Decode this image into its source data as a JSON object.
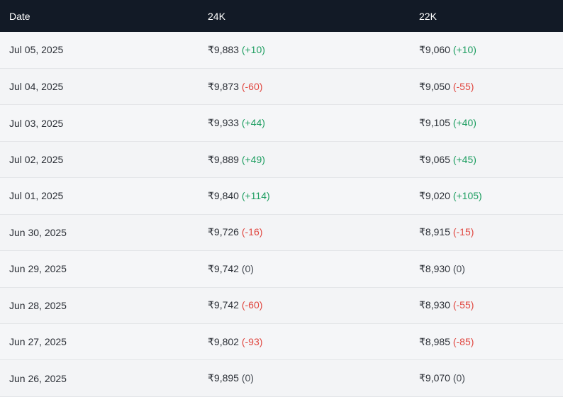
{
  "header": {
    "date_label": "Date",
    "k24_label": "24K",
    "k22_label": "22K"
  },
  "colors": {
    "header_bg": "#121a26",
    "up": "#1e9e61",
    "down": "#e0463f",
    "flat": "#444a52"
  },
  "rows": [
    {
      "date": "Jul 05, 2025",
      "k24": "₹9,883",
      "k24_change": "(+10)",
      "k24_dir": "up",
      "k22": "₹9,060",
      "k22_change": "(+10)",
      "k22_dir": "up"
    },
    {
      "date": "Jul 04, 2025",
      "k24": "₹9,873",
      "k24_change": "(-60)",
      "k24_dir": "down",
      "k22": "₹9,050",
      "k22_change": "(-55)",
      "k22_dir": "down"
    },
    {
      "date": "Jul 03, 2025",
      "k24": "₹9,933",
      "k24_change": "(+44)",
      "k24_dir": "up",
      "k22": "₹9,105",
      "k22_change": "(+40)",
      "k22_dir": "up"
    },
    {
      "date": "Jul 02, 2025",
      "k24": "₹9,889",
      "k24_change": "(+49)",
      "k24_dir": "up",
      "k22": "₹9,065",
      "k22_change": "(+45)",
      "k22_dir": "up"
    },
    {
      "date": "Jul 01, 2025",
      "k24": "₹9,840",
      "k24_change": "(+114)",
      "k24_dir": "up",
      "k22": "₹9,020",
      "k22_change": "(+105)",
      "k22_dir": "up"
    },
    {
      "date": "Jun 30, 2025",
      "k24": "₹9,726",
      "k24_change": "(-16)",
      "k24_dir": "down",
      "k22": "₹8,915",
      "k22_change": "(-15)",
      "k22_dir": "down"
    },
    {
      "date": "Jun 29, 2025",
      "k24": "₹9,742",
      "k24_change": "(0)",
      "k24_dir": "flat",
      "k22": "₹8,930",
      "k22_change": "(0)",
      "k22_dir": "flat"
    },
    {
      "date": "Jun 28, 2025",
      "k24": "₹9,742",
      "k24_change": "(-60)",
      "k24_dir": "down",
      "k22": "₹8,930",
      "k22_change": "(-55)",
      "k22_dir": "down"
    },
    {
      "date": "Jun 27, 2025",
      "k24": "₹9,802",
      "k24_change": "(-93)",
      "k24_dir": "down",
      "k22": "₹8,985",
      "k22_change": "(-85)",
      "k22_dir": "down"
    },
    {
      "date": "Jun 26, 2025",
      "k24": "₹9,895",
      "k24_change": "(0)",
      "k24_dir": "flat",
      "k22": "₹9,070",
      "k22_change": "(0)",
      "k22_dir": "flat"
    }
  ]
}
